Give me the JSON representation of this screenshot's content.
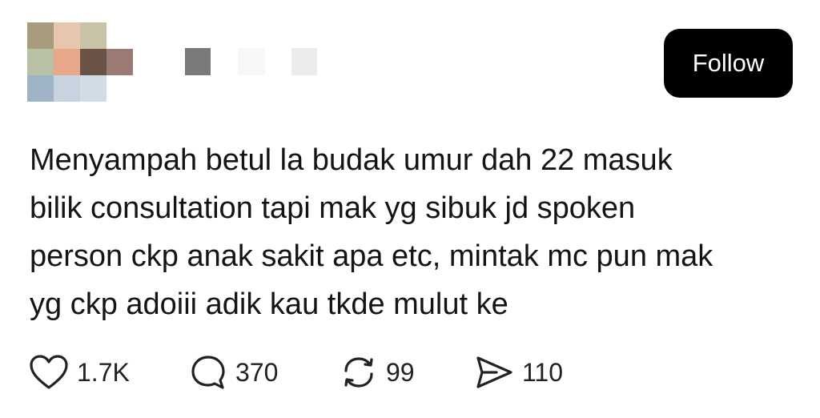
{
  "post": {
    "follow_label": "Follow",
    "text_lines": [
      "Menyampah betul la budak umur dah 22 masuk",
      "bilik consultation tapi mak yg sibuk jd spoken",
      "person ckp anak sakit apa etc, mintak mc pun mak",
      "yg ckp adoiii adik kau tkde mulut ke"
    ],
    "actions": {
      "likes": "1.7K",
      "replies": "370",
      "reposts": "99",
      "shares": "110"
    },
    "icons": {
      "like": "heart-icon",
      "reply": "speech-bubble-icon",
      "repost": "repost-arrows-icon",
      "share": "send-icon"
    }
  },
  "colors": {
    "follow_bg": "#000000",
    "follow_text": "#ffffff",
    "text": "#141414"
  }
}
